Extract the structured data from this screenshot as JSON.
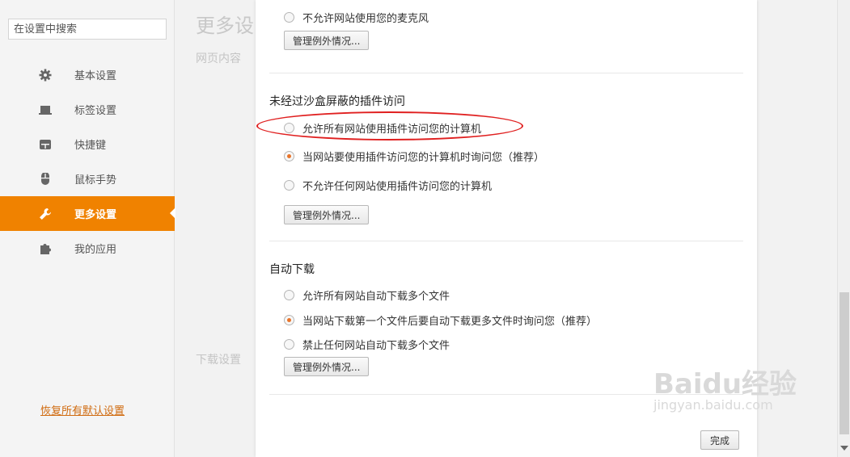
{
  "sidebar": {
    "search_placeholder": "在设置中搜索",
    "items": [
      {
        "label": "基本设置",
        "icon": "gear-icon"
      },
      {
        "label": "标签设置",
        "icon": "tab-icon"
      },
      {
        "label": "快捷键",
        "icon": "keyboard-icon"
      },
      {
        "label": "鼠标手势",
        "icon": "mouse-icon"
      },
      {
        "label": "更多设置",
        "icon": "wrench-icon",
        "active": true
      },
      {
        "label": "我的应用",
        "icon": "puzzle-icon"
      }
    ],
    "restore_label": "恢复所有默认设置"
  },
  "background": {
    "title": "更多设",
    "web_content": "网页内容",
    "download_settings": "下载设置"
  },
  "dialog": {
    "top_radio": "不允许网站使用您的麦克风",
    "top_button": "管理例外情况...",
    "plugin_section": {
      "title": "未经过沙盒屏蔽的插件访问",
      "options": [
        {
          "label": "允许所有网站使用插件访问您的计算机",
          "checked": false
        },
        {
          "label": "当网站要使用插件访问您的计算机时询问您（推荐）",
          "checked": true
        },
        {
          "label": "不允许任何网站使用插件访问您的计算机",
          "checked": false
        }
      ],
      "button": "管理例外情况..."
    },
    "download_section": {
      "title": "自动下载",
      "options": [
        {
          "label": "允许所有网站自动下载多个文件",
          "checked": false
        },
        {
          "label": "当网站下载第一个文件后要自动下载更多文件时询问您（推荐）",
          "checked": true
        },
        {
          "label": "禁止任何网站自动下载多个文件",
          "checked": false
        }
      ],
      "button": "管理例外情况..."
    },
    "done_label": "完成"
  },
  "watermark": {
    "brand": "Baidu经验",
    "url": "jingyan.baidu.com"
  },
  "colors": {
    "accent": "#f08200",
    "annotation": "#e02020"
  }
}
